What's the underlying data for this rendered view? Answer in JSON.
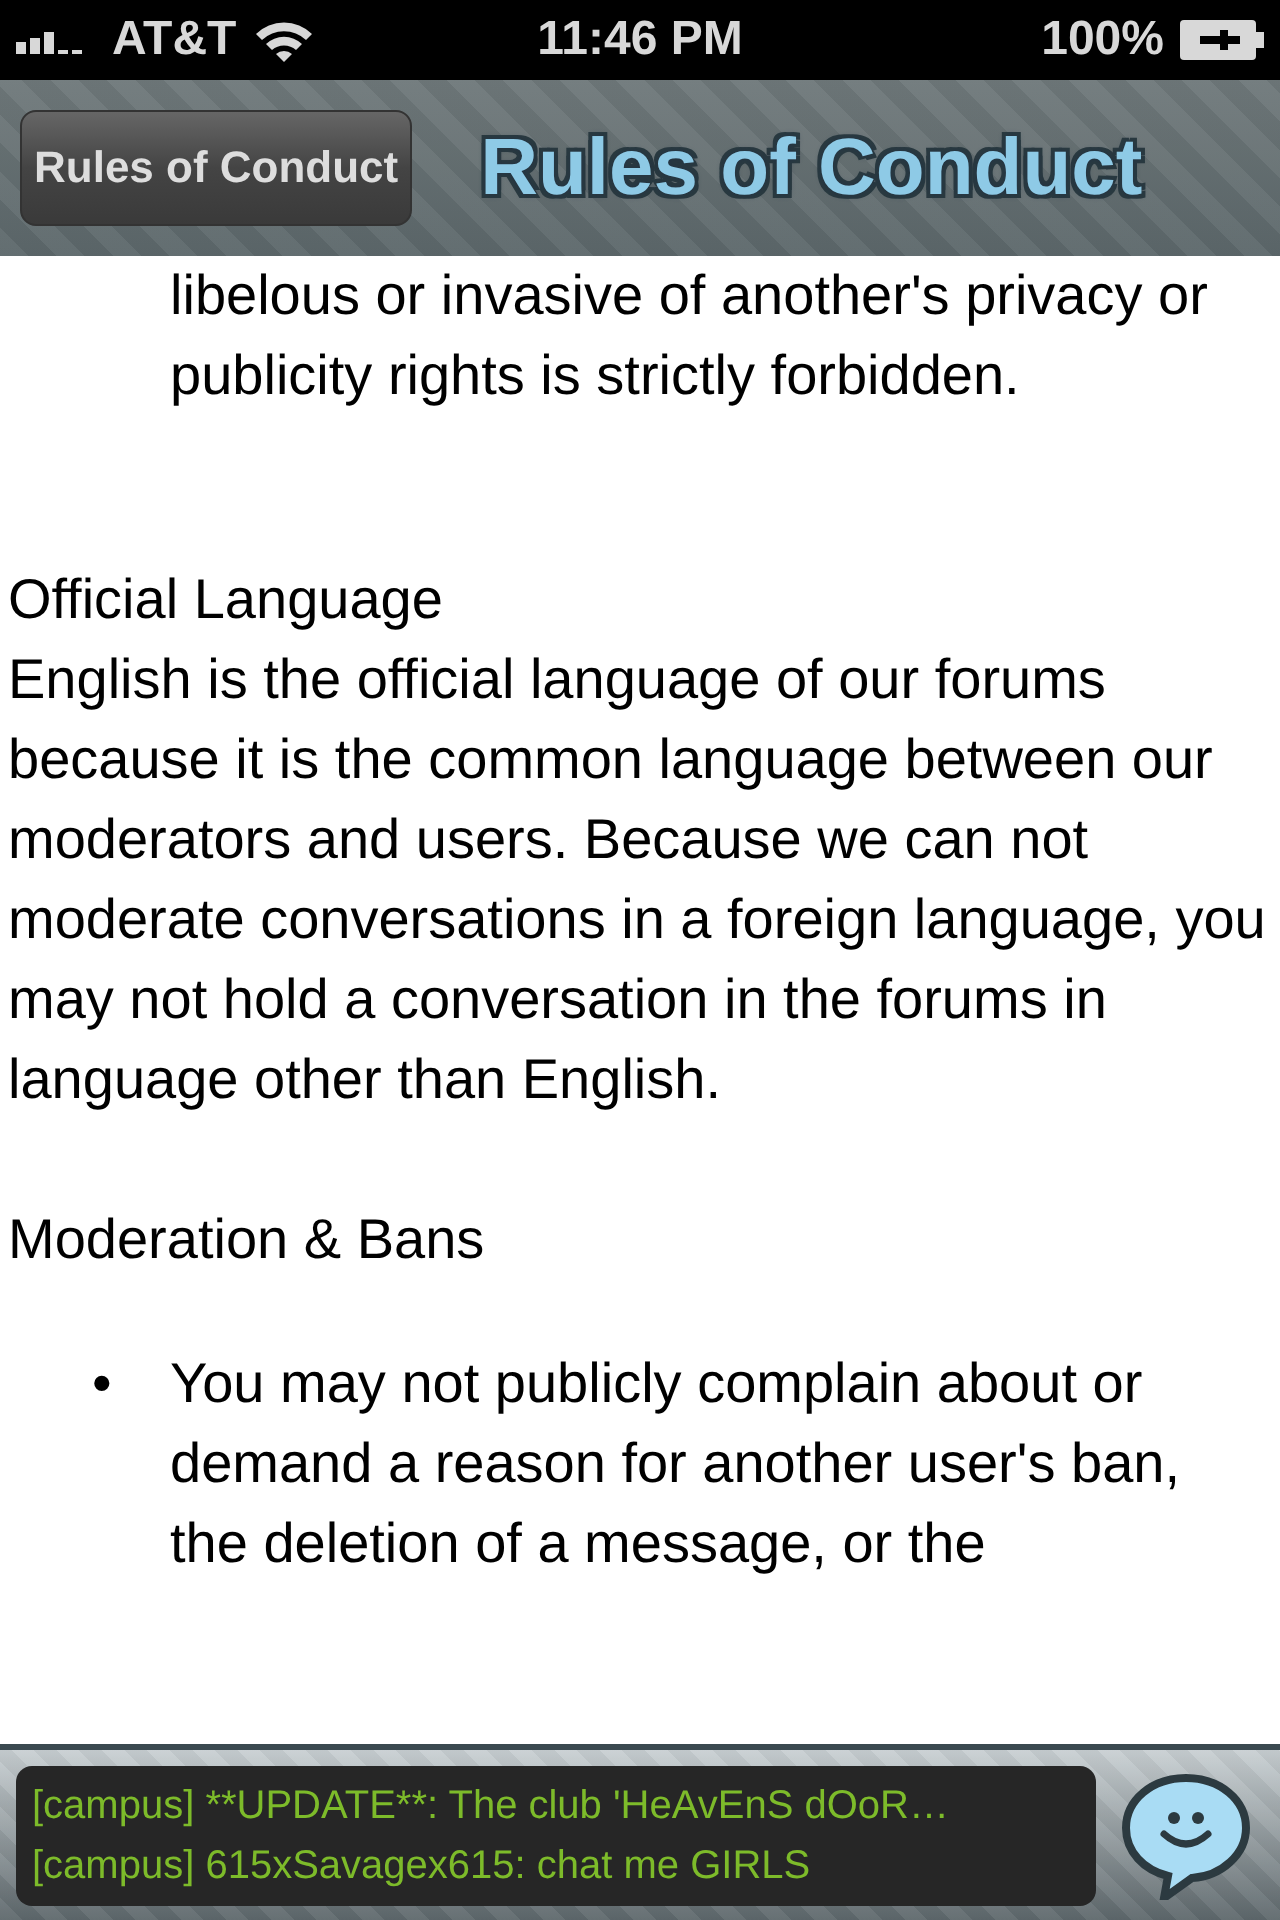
{
  "status_bar": {
    "carrier": "AT&T",
    "time": "11:46 PM",
    "battery": "100%"
  },
  "nav_bar": {
    "back_button": "Rules of Conduct",
    "title": "Rules of Conduct"
  },
  "content": [
    {
      "kind": "continuation",
      "text": "libelous or invasive of another's privacy or publicity rights is strictly forbidden."
    },
    {
      "kind": "heading",
      "text": "Official Language"
    },
    {
      "kind": "paragraph",
      "text": "English is the official language of our forums because it is the common language between our moderators and users. Because we can not moderate conversations in a foreign language, you may not hold a conversation in the forums in language other than English."
    },
    {
      "kind": "heading",
      "text": "Moderation & Bans"
    },
    {
      "kind": "bullet",
      "bullet": "•",
      "text": "You may not publicly complain about or demand a reason for another user's ban, the deletion of a message, or the"
    }
  ],
  "chat_ticker": {
    "messages": [
      "[campus] **UPDATE**: The club 'HeAvEnS dOoR…",
      "[campus] 615xSavagex615: chat me GIRLS"
    ]
  }
}
